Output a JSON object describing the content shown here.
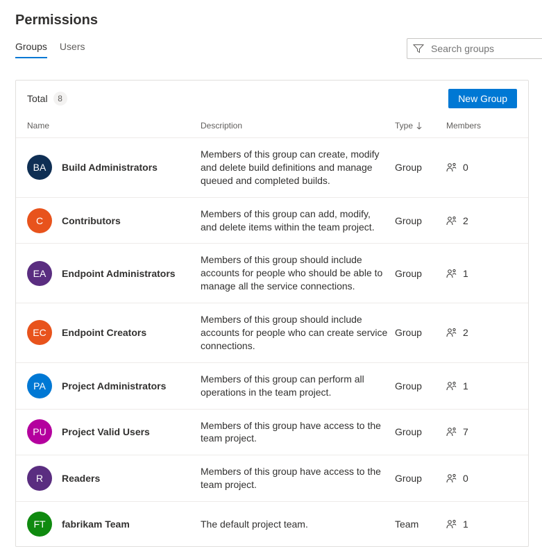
{
  "page": {
    "title": "Permissions"
  },
  "tabs": {
    "groups": "Groups",
    "users": "Users"
  },
  "search": {
    "placeholder": "Search groups"
  },
  "panel": {
    "total_label": "Total",
    "total_count": "8",
    "new_group_btn": "New Group"
  },
  "columns": {
    "name": "Name",
    "description": "Description",
    "type": "Type",
    "members": "Members"
  },
  "rows": [
    {
      "initials": "BA",
      "color": "#0f2f54",
      "name": "Build Administrators",
      "description": "Members of this group can create, modify and delete build definitions and manage queued and completed builds.",
      "type": "Group",
      "members": "0"
    },
    {
      "initials": "C",
      "color": "#e8531c",
      "name": "Contributors",
      "description": "Members of this group can add, modify, and delete items within the team project.",
      "type": "Group",
      "members": "2"
    },
    {
      "initials": "EA",
      "color": "#5a2d80",
      "name": "Endpoint Administrators",
      "description": "Members of this group should include accounts for people who should be able to manage all the service connections.",
      "type": "Group",
      "members": "1"
    },
    {
      "initials": "EC",
      "color": "#e8531c",
      "name": "Endpoint Creators",
      "description": "Members of this group should include accounts for people who can create service connections.",
      "type": "Group",
      "members": "2"
    },
    {
      "initials": "PA",
      "color": "#0078d4",
      "name": "Project Administrators",
      "description": "Members of this group can perform all operations in the team project.",
      "type": "Group",
      "members": "1"
    },
    {
      "initials": "PU",
      "color": "#b4009e",
      "name": "Project Valid Users",
      "description": "Members of this group have access to the team project.",
      "type": "Group",
      "members": "7"
    },
    {
      "initials": "R",
      "color": "#5a2d80",
      "name": "Readers",
      "description": "Members of this group have access to the team project.",
      "type": "Group",
      "members": "0"
    },
    {
      "initials": "FT",
      "color": "#0f8a0f",
      "name": "fabrikam Team",
      "description": "The default project team.",
      "type": "Team",
      "members": "1"
    }
  ]
}
